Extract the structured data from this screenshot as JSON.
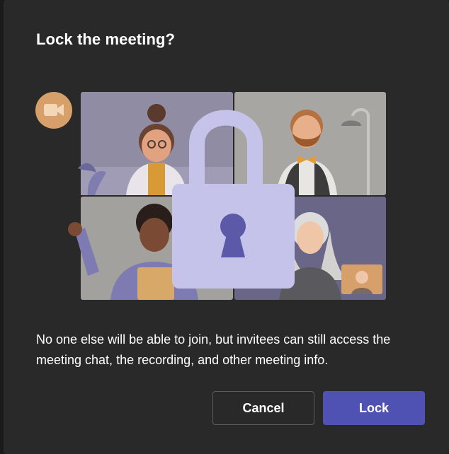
{
  "dialog": {
    "title": "Lock the meeting?",
    "message": "No one else will be able to join, but invitees can still access the meeting chat, the recording, and other meeting info.",
    "cancel_label": "Cancel",
    "lock_label": "Lock"
  },
  "illustration": {
    "icons": [
      "video-camera-icon",
      "padlock-icon",
      "keyhole-icon"
    ],
    "colors": {
      "accent": "#4f52b2",
      "padlock": "#c5c3ea",
      "camera_badge": "#d7a06a",
      "panel_top_left": "#908ca4",
      "panel_top_right": "#a8a6a2",
      "panel_bottom_left": "#a3a19e",
      "panel_bottom_right": "#6a6688"
    }
  }
}
